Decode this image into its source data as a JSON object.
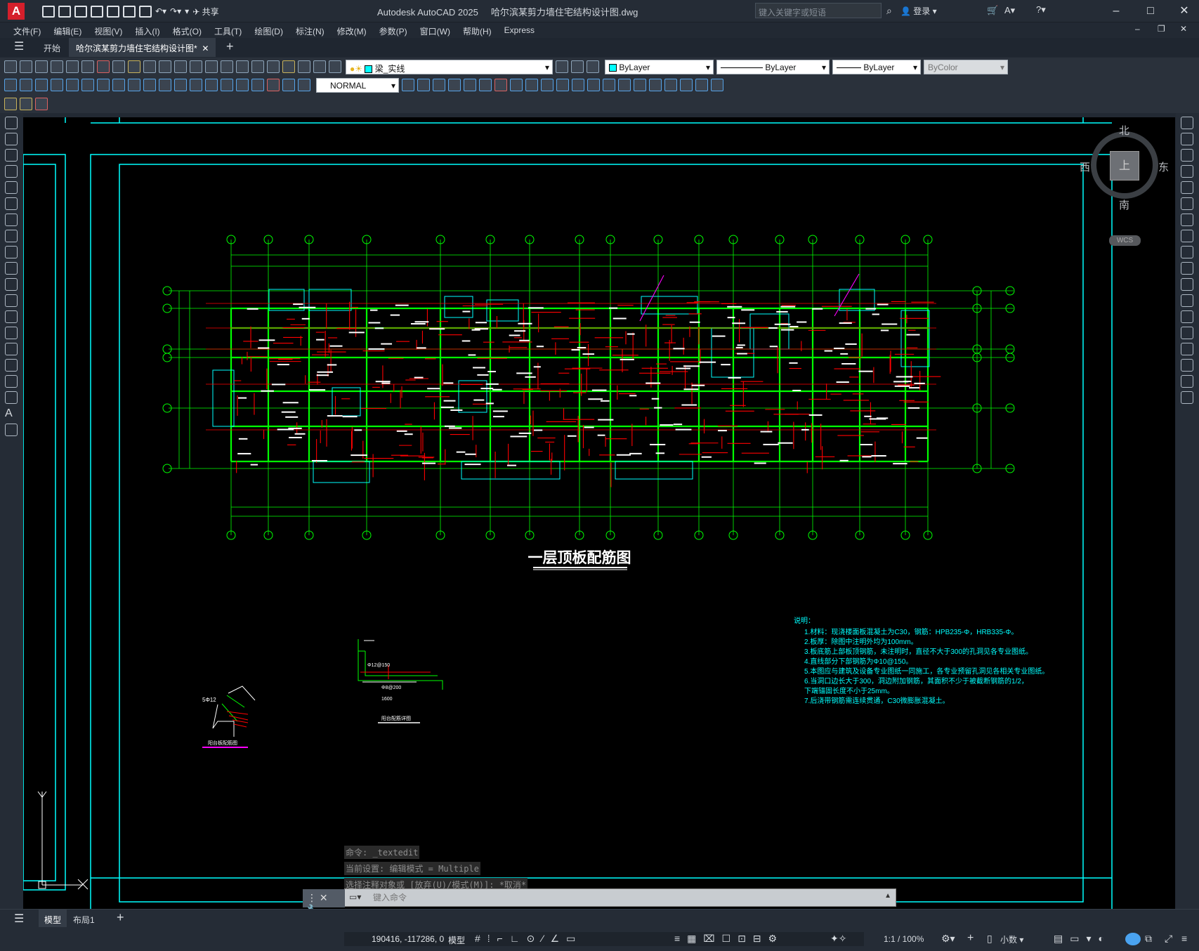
{
  "titlebar": {
    "app_title": "Autodesk AutoCAD 2025",
    "document_title": "哈尔滨某剪力墙住宅结构设计图.dwg",
    "share_label": "共享",
    "search_placeholder": "键入关键字或短语",
    "login_label": "登录"
  },
  "menu": [
    "文件(F)",
    "编辑(E)",
    "视图(V)",
    "插入(I)",
    "格式(O)",
    "工具(T)",
    "绘图(D)",
    "标注(N)",
    "修改(M)",
    "参数(P)",
    "窗口(W)",
    "帮助(H)",
    "Express"
  ],
  "tabs": {
    "start": "开始",
    "active": "哈尔滨某剪力墙住宅结构设计图*"
  },
  "toolbar": {
    "layer_name": "梁_实线",
    "color": "ByLayer",
    "linetype": "ByLayer",
    "lineweight": "ByLayer",
    "plotstyle": "ByColor",
    "textstyle": "NORMAL"
  },
  "viewcube": {
    "north": "北",
    "south": "南",
    "east": "东",
    "west": "西",
    "top": "上",
    "wcs": "WCS"
  },
  "drawing": {
    "title": "一层顶板配筋图",
    "detail1_title": "阳台板配筋图",
    "detail2_title": "阳台配筋详图",
    "notes_title": "说明：",
    "notes": [
      "1.材料：现浇楼面板混凝土为C30，钢筋：HPB235-Φ，HRB335-Φ。",
      "2.板厚：除图中注明外均为100mm。",
      "3.板底筋上部板顶钢筋，未注明时，直径不大于300的孔洞见各专业图纸。",
      "4.直线部分下部钢筋为Φ10@150。",
      "5.本图应与建筑及设备专业图纸一同施工，各专业预留孔洞见各相关专业图纸。",
      "6.当洞口边长大于300，洞边附加钢筋，其面积不少于被截断钢筋的1/2，",
      "  下端锚固长度不小于25mm。",
      "7.后浇带钢筋需连续贯通，C30微膨胀混凝土。"
    ]
  },
  "command": {
    "log": [
      "命令: _textedit",
      "当前设置: 编辑模式 = Multiple",
      "选择注释对象或 [放弃(U)/模式(M)]: *取消*"
    ],
    "placeholder": "键入命令"
  },
  "status": {
    "model_tab": "模型",
    "layout_tab": "布局1",
    "coords": "190416, -117286, 0",
    "model_label": "模型",
    "scale": "1:1 / 100%",
    "units": "小数"
  },
  "colors": {
    "canvas_bg": "#000000",
    "cyan": "#00ffff",
    "green": "#00ff00",
    "red": "#ff0000",
    "magenta": "#ff00ff"
  }
}
